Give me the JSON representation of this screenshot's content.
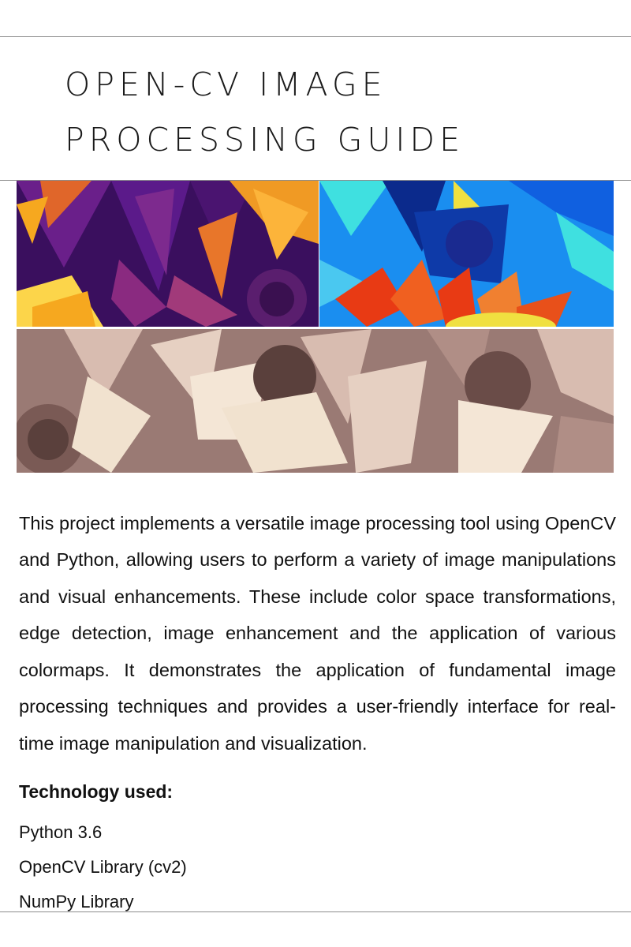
{
  "document": {
    "title_lines": [
      "OPEN-CV IMAGE",
      "PROCESSING GUIDE"
    ],
    "cover_images": [
      {
        "name": "flower-inferno-colormap",
        "palette": [
          "#2a0a4a",
          "#5b1a8a",
          "#a13a7a",
          "#e0662a",
          "#f6a81f",
          "#fcd54a"
        ]
      },
      {
        "name": "flower-jet-colormap",
        "palette": [
          "#0b2a8c",
          "#1060e0",
          "#1aa8f0",
          "#3fe0e0",
          "#f0e040",
          "#e83a14"
        ]
      },
      {
        "name": "flower-pink-colormap",
        "palette": [
          "#3a2a28",
          "#7a5a55",
          "#b08e86",
          "#d8bcb0",
          "#f1e2cf"
        ]
      }
    ],
    "description": "This project implements a versatile image processing tool using OpenCV and Python, allowing users to perform a variety of image manipulations and visual enhancements. These include color space transformations, edge detection, image enhancement and the application of various colormaps. It demonstrates the application of fundamental image processing techniques and provides a user-friendly interface for real-time image manipulation and visualization.",
    "technology_heading": "Technology used:",
    "technologies": [
      "Python 3.6",
      "OpenCV Library (cv2)",
      "NumPy Library"
    ]
  }
}
